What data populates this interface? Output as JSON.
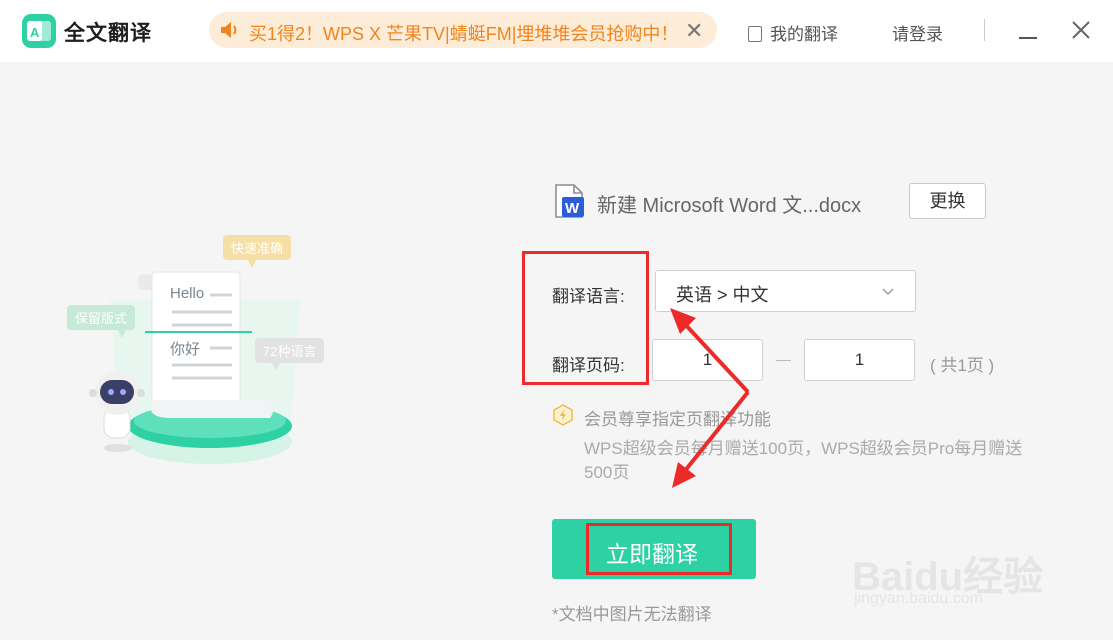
{
  "app": {
    "title": "全文翻译",
    "logo_glyph": "A"
  },
  "promo": {
    "text": "买1得2！WPS X 芒果TV|蜻蜓FM|埋堆堆会员抢购中！",
    "close": "✕"
  },
  "header": {
    "my_translations": "我的翻译",
    "login": "请登录"
  },
  "illustration": {
    "tag_fast": "快速准确",
    "tag_layout": "保留版式",
    "tag_langs": "72种语言",
    "sample_en": "Hello",
    "sample_zh": "你好"
  },
  "file": {
    "name": "新建 Microsoft Word 文...docx",
    "change_label": "更换"
  },
  "form": {
    "language_label": "翻译语言:",
    "language_value": "英语 > 中文",
    "pages_label": "翻译页码:",
    "page_from": "1",
    "page_to": "1",
    "page_total": "( 共1页 )"
  },
  "vip": {
    "title": "会员尊享指定页翻译功能",
    "desc": "WPS超级会员每月赠送100页，WPS超级会员Pro每月赠送500页"
  },
  "action": {
    "translate_label": "立即翻译",
    "note": "*文档中图片无法翻译"
  },
  "watermark": {
    "text": "Baidu经验",
    "sub": "jingyan.baidu.com"
  },
  "colors": {
    "accent": "#2ed1a4",
    "promo_text": "#f0851e",
    "annotation": "#ec2a2a"
  }
}
